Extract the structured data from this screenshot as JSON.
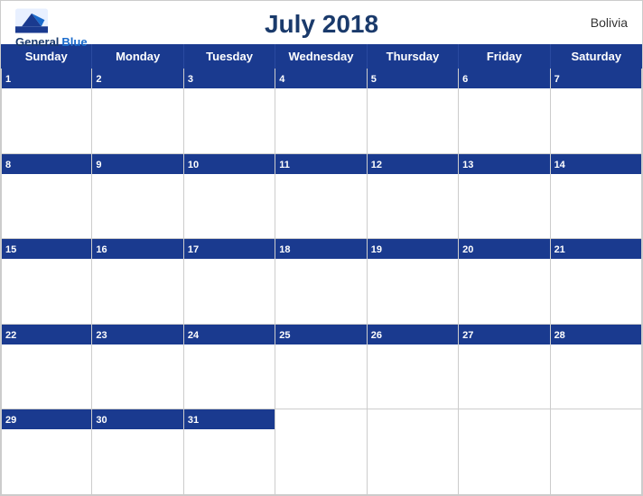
{
  "header": {
    "title": "July 2018",
    "country": "Bolivia",
    "logo": {
      "line1": "General",
      "line2": "Blue"
    }
  },
  "days_of_week": [
    "Sunday",
    "Monday",
    "Tuesday",
    "Wednesday",
    "Thursday",
    "Friday",
    "Saturday"
  ],
  "weeks": [
    [
      {
        "date": 1,
        "empty": false
      },
      {
        "date": 2,
        "empty": false
      },
      {
        "date": 3,
        "empty": false
      },
      {
        "date": 4,
        "empty": false
      },
      {
        "date": 5,
        "empty": false
      },
      {
        "date": 6,
        "empty": false
      },
      {
        "date": 7,
        "empty": false
      }
    ],
    [
      {
        "date": 8,
        "empty": false
      },
      {
        "date": 9,
        "empty": false
      },
      {
        "date": 10,
        "empty": false
      },
      {
        "date": 11,
        "empty": false
      },
      {
        "date": 12,
        "empty": false
      },
      {
        "date": 13,
        "empty": false
      },
      {
        "date": 14,
        "empty": false
      }
    ],
    [
      {
        "date": 15,
        "empty": false
      },
      {
        "date": 16,
        "empty": false
      },
      {
        "date": 17,
        "empty": false
      },
      {
        "date": 18,
        "empty": false
      },
      {
        "date": 19,
        "empty": false
      },
      {
        "date": 20,
        "empty": false
      },
      {
        "date": 21,
        "empty": false
      }
    ],
    [
      {
        "date": 22,
        "empty": false
      },
      {
        "date": 23,
        "empty": false
      },
      {
        "date": 24,
        "empty": false
      },
      {
        "date": 25,
        "empty": false
      },
      {
        "date": 26,
        "empty": false
      },
      {
        "date": 27,
        "empty": false
      },
      {
        "date": 28,
        "empty": false
      }
    ],
    [
      {
        "date": 29,
        "empty": false
      },
      {
        "date": 30,
        "empty": false
      },
      {
        "date": 31,
        "empty": false
      },
      {
        "date": "",
        "empty": true
      },
      {
        "date": "",
        "empty": true
      },
      {
        "date": "",
        "empty": true
      },
      {
        "date": "",
        "empty": true
      }
    ]
  ],
  "colors": {
    "header_bg": "#1a3a8f",
    "header_text": "#ffffff",
    "title_color": "#1a3a6b",
    "border": "#cccccc",
    "logo_general": "#1a3a6b",
    "logo_blue": "#1a6bcc"
  }
}
